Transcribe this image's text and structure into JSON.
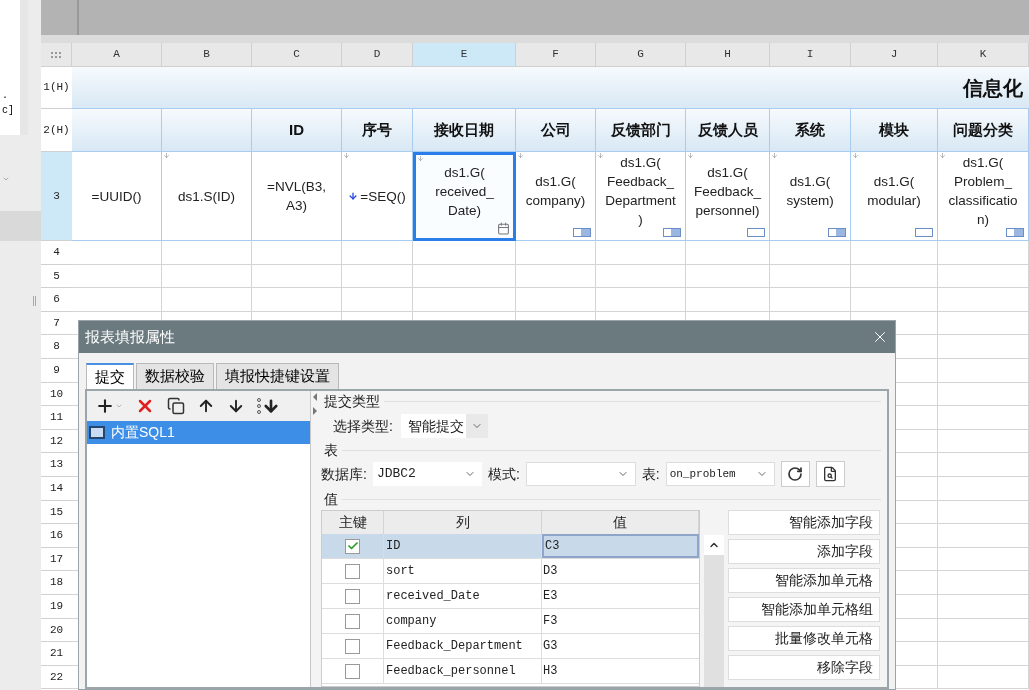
{
  "side_panel": {
    "snippet": ". c]"
  },
  "sheet": {
    "columns": [
      {
        "label": "A",
        "selected": false
      },
      {
        "label": "B",
        "selected": false
      },
      {
        "label": "C",
        "selected": false
      },
      {
        "label": "D",
        "selected": false
      },
      {
        "label": "E",
        "selected": true
      },
      {
        "label": "F",
        "selected": false
      },
      {
        "label": "G",
        "selected": false
      },
      {
        "label": "H",
        "selected": false
      },
      {
        "label": "I",
        "selected": false
      },
      {
        "label": "J",
        "selected": false
      },
      {
        "label": "K",
        "selected": false
      }
    ],
    "rows": [
      {
        "label": "1(H)",
        "selected": false
      },
      {
        "label": "2(H)",
        "selected": false
      },
      {
        "label": "3",
        "selected": true
      },
      {
        "label": "4",
        "selected": false
      },
      {
        "label": "5",
        "selected": false
      },
      {
        "label": "6",
        "selected": false
      },
      {
        "label": "7",
        "selected": false
      },
      {
        "label": "8",
        "selected": false
      },
      {
        "label": "9",
        "selected": false
      },
      {
        "label": "10",
        "selected": false
      },
      {
        "label": "11",
        "selected": false
      },
      {
        "label": "12",
        "selected": false
      },
      {
        "label": "13",
        "selected": false
      },
      {
        "label": "14",
        "selected": false
      },
      {
        "label": "15",
        "selected": false
      },
      {
        "label": "16",
        "selected": false
      },
      {
        "label": "17",
        "selected": false
      },
      {
        "label": "18",
        "selected": false
      },
      {
        "label": "19",
        "selected": false
      },
      {
        "label": "20",
        "selected": false
      },
      {
        "label": "21",
        "selected": false
      },
      {
        "label": "22",
        "selected": false
      }
    ],
    "title": "信息化",
    "headers": [
      "ID",
      "序号",
      "接收日期",
      "公司",
      "反馈部门",
      "反馈人员",
      "系统",
      "模块",
      "问题分类"
    ],
    "cells": [
      {
        "text": "=UUID()",
        "expand": false,
        "sort_arrow": false,
        "kind": "plain",
        "selected": false
      },
      {
        "text": "ds1.S(ID)",
        "expand": true,
        "sort_arrow": false,
        "kind": "plain",
        "selected": false
      },
      {
        "text": "=NVL(B3,\nA3)",
        "expand": false,
        "sort_arrow": false,
        "kind": "plain",
        "selected": false
      },
      {
        "text": "=SEQ()",
        "expand": true,
        "sort_arrow": true,
        "kind": "plain",
        "selected": false
      },
      {
        "text": "ds1.G(\nreceived_\nDate)",
        "expand": true,
        "sort_arrow": false,
        "kind": "calendar",
        "selected": true
      },
      {
        "text": "ds1.G(\ncompany)",
        "expand": true,
        "sort_arrow": false,
        "kind": "dropdown",
        "selected": false
      },
      {
        "text": "ds1.G(\nFeedback_\nDepartment\n)",
        "expand": true,
        "sort_arrow": false,
        "kind": "dropdown",
        "selected": false
      },
      {
        "text": "ds1.G(\nFeedback_\npersonnel)",
        "expand": true,
        "sort_arrow": false,
        "kind": "text",
        "selected": false
      },
      {
        "text": "ds1.G(\nsystem)",
        "expand": true,
        "sort_arrow": false,
        "kind": "dropdown",
        "selected": false
      },
      {
        "text": "ds1.G(\nmodular)",
        "expand": true,
        "sort_arrow": false,
        "kind": "text",
        "selected": false
      },
      {
        "text": "ds1.G(\nProblem_\nclassificatio\nn)",
        "expand": true,
        "sort_arrow": false,
        "kind": "dropdown",
        "selected": false
      }
    ]
  },
  "dialog": {
    "title": "报表填报属性",
    "tabs": [
      {
        "label": "提交",
        "selected": true
      },
      {
        "label": "数据校验",
        "selected": false
      },
      {
        "label": "填报快捷键设置",
        "selected": false
      }
    ],
    "items": [
      {
        "label": "内置SQL1",
        "selected": true
      }
    ],
    "submit_section": "提交类型",
    "type_label": "选择类型:",
    "type_value": "智能提交",
    "table_section": "表",
    "db_label": "数据库:",
    "db_value": "JDBC2",
    "schema_label": "模式:",
    "table_label": "表:",
    "table_value": "on_problem",
    "values_section": "值",
    "grid_columns": [
      "主键",
      "列",
      "值"
    ],
    "grid_rows": [
      {
        "key": true,
        "column": "ID",
        "value": "C3",
        "selected": true
      },
      {
        "key": false,
        "column": "sort",
        "value": "D3",
        "selected": false
      },
      {
        "key": false,
        "column": "received_Date",
        "value": "E3",
        "selected": false
      },
      {
        "key": false,
        "column": "company",
        "value": "F3",
        "selected": false
      },
      {
        "key": false,
        "column": "Feedback_Department",
        "value": "G3",
        "selected": false
      },
      {
        "key": false,
        "column": "Feedback_personnel",
        "value": "H3",
        "selected": false
      }
    ],
    "buttons": [
      "智能添加字段",
      "添加字段",
      "智能添加单元格",
      "智能添加单元格组",
      "批量修改单元格",
      "移除字段"
    ]
  }
}
